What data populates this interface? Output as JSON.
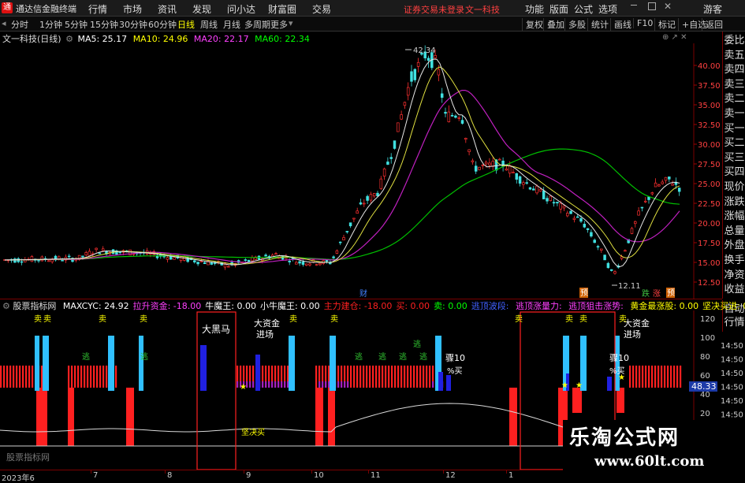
{
  "titlebar": {
    "app_name": "通达信金融终端",
    "menus": [
      "行情",
      "市场",
      "资讯",
      "发现",
      "问小达",
      "财富圈",
      "交易"
    ],
    "login_notice": "证券交易未登录",
    "stock_notice": "文一科技",
    "right_menus": [
      "功能",
      "版面",
      "公式",
      "选项"
    ],
    "guest": "游客"
  },
  "toolbar": {
    "periods": [
      "分时",
      "1分钟",
      "5分钟",
      "15分钟",
      "30分钟",
      "60分钟",
      "日线",
      "周线",
      "月线",
      "多周期",
      "更多"
    ],
    "right": [
      "复权",
      "叠加",
      "多股",
      "统计",
      "画线",
      "F10",
      "标记",
      "+自选",
      "返回"
    ]
  },
  "main": {
    "stock_title": "文一科技(日线)",
    "ma": [
      {
        "label": "MA5: 25.17",
        "color": "#ffffff"
      },
      {
        "label": "MA10: 24.96",
        "color": "#ffff00"
      },
      {
        "label": "MA20: 22.17",
        "color": "#ff40ff"
      },
      {
        "label": "MA60: 22.34",
        "color": "#00ff00"
      }
    ],
    "price_axis": [
      "40.00",
      "37.50",
      "35.00",
      "32.50",
      "30.00",
      "27.50",
      "25.00",
      "22.50",
      "20.00",
      "17.50",
      "15.00",
      "12.50"
    ],
    "high_label": "42.34",
    "low_label": "12.11",
    "event_markers": [
      "财",
      "预",
      "跌",
      "涨",
      "预"
    ]
  },
  "right_panel": {
    "items": [
      "委比",
      "卖五",
      "卖四",
      "卖三",
      "卖二",
      "卖一",
      "买一",
      "买二",
      "买三",
      "买四",
      "现价",
      "涨跌",
      "涨幅",
      "总量",
      "外盘",
      "换手",
      "净资",
      "收益"
    ],
    "items2": [
      "自动",
      "行情"
    ]
  },
  "indicator": {
    "name": "股票指标网",
    "values": [
      {
        "label": "MAXCYC: 24.92",
        "color": "#ffffff"
      },
      {
        "label": "拉升资金: -18.00",
        "color": "#ff40ff"
      },
      {
        "label": "牛魔王: 0.00",
        "color": "#ffffff"
      },
      {
        "label": "小牛魔王: 0.00",
        "color": "#ffffff"
      },
      {
        "label": "主力建仓: -18.00",
        "color": "#ff2020"
      },
      {
        "label": "买: 0.00",
        "color": "#ff2020"
      },
      {
        "label": "卖: 0.00",
        "color": "#00ff00"
      },
      {
        "label": "逃顶波段: ",
        "color": "#4060ff"
      },
      {
        "label": "逃顶涨量力: ",
        "color": "#ff40ff"
      },
      {
        "label": "逃顶狙击涨势: ",
        "color": "#ff40ff"
      },
      {
        "label": "黄金最涨股: 0.00",
        "color": "#ffff00"
      },
      {
        "label": "坚决买进: 0.00",
        "color": "#ffff00"
      }
    ],
    "axis": [
      "120",
      "100",
      "80",
      "60",
      "40",
      "20"
    ],
    "value_box": "48.33",
    "time_labels": [
      "14:50",
      "14:50",
      "14:50",
      "14:50",
      "14:50",
      "14:50",
      "14:50"
    ],
    "annotations": {
      "big_black_horse": "大黑马",
      "big_funds_1": "大资金",
      "enter_1": "进场",
      "big_funds_2": "大资金",
      "enter_2": "进场",
      "sell": "卖",
      "escape": "逃",
      "jump_10": "骤10",
      "pct_buy": "%买",
      "firm_buy": "坚决买",
      "watermark_small": "股票指标网"
    }
  },
  "time_axis": [
    "2023年6",
    "7",
    "8",
    "9",
    "10",
    "11",
    "12",
    "1"
  ],
  "watermark": {
    "title": "乐淘公式网",
    "url": "www.60lt.com"
  }
}
